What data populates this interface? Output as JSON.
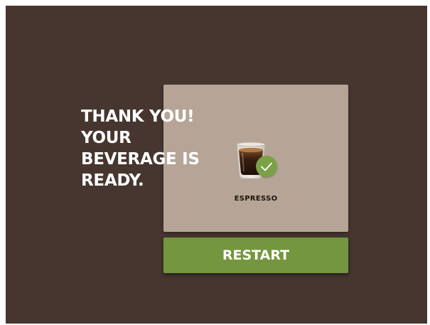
{
  "message": {
    "lines": [
      "THANK YOU!",
      "YOUR",
      "BEVERAGE IS",
      "READY."
    ]
  },
  "beverage": {
    "name": "ESPRESSO",
    "icon": "espresso-cup-icon",
    "status_icon": "check-icon"
  },
  "actions": {
    "restart_label": "RESTART"
  },
  "colors": {
    "background": "#46362f",
    "card": "#b6a597",
    "accent_green": "#74963f",
    "text_light": "#ffffff",
    "text_dark": "#1c140f"
  }
}
